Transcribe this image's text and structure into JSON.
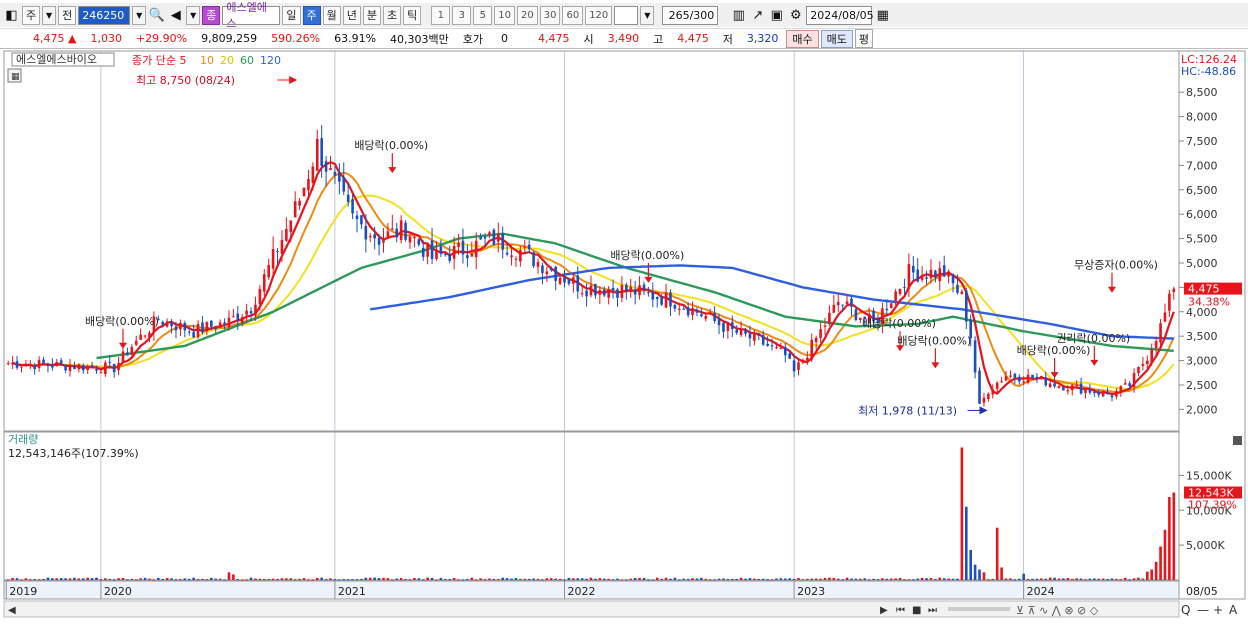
{
  "toolbar": {
    "market": "주",
    "prev_label": "전",
    "code": "246250",
    "name_badge": "종",
    "stock_name": "에스엘에스",
    "periods": [
      "일",
      "주",
      "월",
      "년",
      "분",
      "초",
      "틱"
    ],
    "active_period": "주",
    "intervals": [
      "1",
      "3",
      "5",
      "10",
      "20",
      "30",
      "60",
      "120"
    ],
    "count": "265",
    "count_max": "/300",
    "date": "2024/08/05"
  },
  "quote": {
    "price": "4,475",
    "change": "1,030",
    "change_pct": "+29.90%",
    "volume": "9,809,259",
    "vol_pct": "590.26%",
    "turnover": "63.91%",
    "amount": "40,303백만",
    "hoga_label": "호가",
    "hoga_value": "0",
    "hoga_price": "4,475",
    "open_label": "시",
    "open": "3,490",
    "high_label": "고",
    "high": "4,475",
    "low_label": "저",
    "low": "3,320",
    "buy_label": "매수",
    "sell_label": "매도",
    "eval_label": "평"
  },
  "colors": {
    "up": "#e8141b",
    "down": "#1a4fc4",
    "ma5": "#e8141b",
    "ma10": "#f08a10",
    "ma20": "#f5e020",
    "ma60": "#2e9a5a",
    "ma120": "#2f5fe0"
  },
  "chart_data": [
    {
      "type": "candlestick",
      "title": "에스엘에스바이오",
      "legend": [
        {
          "label": "종가 단순 5"
        },
        {
          "label": "10"
        },
        {
          "label": "20"
        },
        {
          "label": "60"
        },
        {
          "label": "120"
        }
      ],
      "ylim": [
        1700,
        8750
      ],
      "y_ticks": [
        "2,000",
        "2,500",
        "3,000",
        "3,500",
        "4,000",
        "4,500",
        "5,000",
        "5,500",
        "6,000",
        "6,500",
        "7,000",
        "7,500",
        "8,000",
        "8,500"
      ],
      "x_ticks": [
        "2019",
        "2020",
        "2021",
        "2022",
        "2023",
        "2024",
        "08/05"
      ],
      "lc_label": "LC:126.24",
      "hc_label": "HC:-48.86",
      "last_price_label": "4,475",
      "last_pct_label": "34.38%",
      "max_label": "최고 8,750 (08/24)",
      "min_label": "최저 1,978 (11/13)",
      "events": [
        {
          "label": "배당락(0.00%)",
          "price": 3200
        },
        {
          "label": "배당락(0.00%)",
          "price": 6800
        },
        {
          "label": "배당락(0.00%)",
          "price": 4550
        },
        {
          "label": "배당락(0.00%)",
          "price": 3150
        },
        {
          "label": "배당락(0.00%)",
          "price": 2800
        },
        {
          "label": "배당락(0.00%)",
          "price": 2600
        },
        {
          "label": "권리락(0.00%)",
          "price": 2850
        },
        {
          "label": "무상증자(0.00%)",
          "price": 4350
        }
      ],
      "series_anchors": {
        "close_w": [
          [
            0,
            2950
          ],
          [
            24,
            2850
          ],
          [
            28,
            3300
          ],
          [
            34,
            3850
          ],
          [
            42,
            3600
          ],
          [
            50,
            3800
          ],
          [
            55,
            4100
          ],
          [
            60,
            5100
          ],
          [
            66,
            6300
          ],
          [
            70,
            7400
          ],
          [
            74,
            6600
          ],
          [
            78,
            5900
          ],
          [
            84,
            5500
          ],
          [
            90,
            5700
          ],
          [
            96,
            5100
          ],
          [
            104,
            5300
          ],
          [
            110,
            5500
          ],
          [
            116,
            5250
          ],
          [
            124,
            4800
          ],
          [
            130,
            4500
          ],
          [
            140,
            4450
          ],
          [
            150,
            4250
          ],
          [
            156,
            4000
          ],
          [
            164,
            3600
          ],
          [
            170,
            3400
          ],
          [
            176,
            3100
          ],
          [
            178,
            2750
          ],
          [
            182,
            3300
          ],
          [
            188,
            4200
          ],
          [
            196,
            3750
          ],
          [
            204,
            4800
          ],
          [
            212,
            4800
          ],
          [
            216,
            4300
          ],
          [
            218,
            3500
          ],
          [
            220,
            2050
          ],
          [
            222,
            2400
          ],
          [
            226,
            2700
          ],
          [
            232,
            2650
          ],
          [
            238,
            2500
          ],
          [
            244,
            2400
          ],
          [
            250,
            2300
          ],
          [
            254,
            2500
          ],
          [
            258,
            3100
          ],
          [
            261,
            3700
          ],
          [
            264,
            4475
          ]
        ],
        "ma60": [
          [
            20,
            3050
          ],
          [
            40,
            3300
          ],
          [
            60,
            4000
          ],
          [
            80,
            4900
          ],
          [
            94,
            5250
          ],
          [
            102,
            5500
          ],
          [
            112,
            5600
          ],
          [
            124,
            5400
          ],
          [
            140,
            4900
          ],
          [
            160,
            4400
          ],
          [
            176,
            3900
          ],
          [
            192,
            3700
          ],
          [
            206,
            3750
          ],
          [
            214,
            3900
          ],
          [
            230,
            3600
          ],
          [
            250,
            3300
          ],
          [
            264,
            3200
          ]
        ],
        "ma120": [
          [
            82,
            4050
          ],
          [
            100,
            4300
          ],
          [
            118,
            4650
          ],
          [
            136,
            4900
          ],
          [
            152,
            4950
          ],
          [
            164,
            4900
          ],
          [
            180,
            4500
          ],
          [
            196,
            4250
          ],
          [
            216,
            4050
          ],
          [
            236,
            3750
          ],
          [
            250,
            3500
          ],
          [
            264,
            3450
          ]
        ]
      }
    },
    {
      "type": "bar",
      "title": "거래량",
      "value_label": "12,543,146주(107.39%)",
      "y_ticks": [
        "5,000K",
        "10,000K",
        "15,000K"
      ],
      "ylim": [
        0,
        19500
      ],
      "last_label": "12,543K",
      "last_pct_label": "107.39%",
      "spikes": [
        {
          "bar": 50,
          "value": 1100
        },
        {
          "bar": 51,
          "value": 800
        },
        {
          "bar": 216,
          "value": 19000
        },
        {
          "bar": 217,
          "value": 10500
        },
        {
          "bar": 218,
          "value": 4300
        },
        {
          "bar": 219,
          "value": 2200
        },
        {
          "bar": 220,
          "value": 1500
        },
        {
          "bar": 221,
          "value": 1100
        },
        {
          "bar": 224,
          "value": 7500
        },
        {
          "bar": 225,
          "value": 1800
        },
        {
          "bar": 230,
          "value": 900
        },
        {
          "bar": 258,
          "value": 1200
        },
        {
          "bar": 259,
          "value": 1500
        },
        {
          "bar": 260,
          "value": 2600
        },
        {
          "bar": 261,
          "value": 4800
        },
        {
          "bar": 262,
          "value": 7200
        },
        {
          "bar": 263,
          "value": 11900
        },
        {
          "bar": 264,
          "value": 12543
        }
      ]
    }
  ],
  "footer": {
    "zoom_buttons": [
      "Q",
      "—",
      "+",
      "A"
    ]
  }
}
